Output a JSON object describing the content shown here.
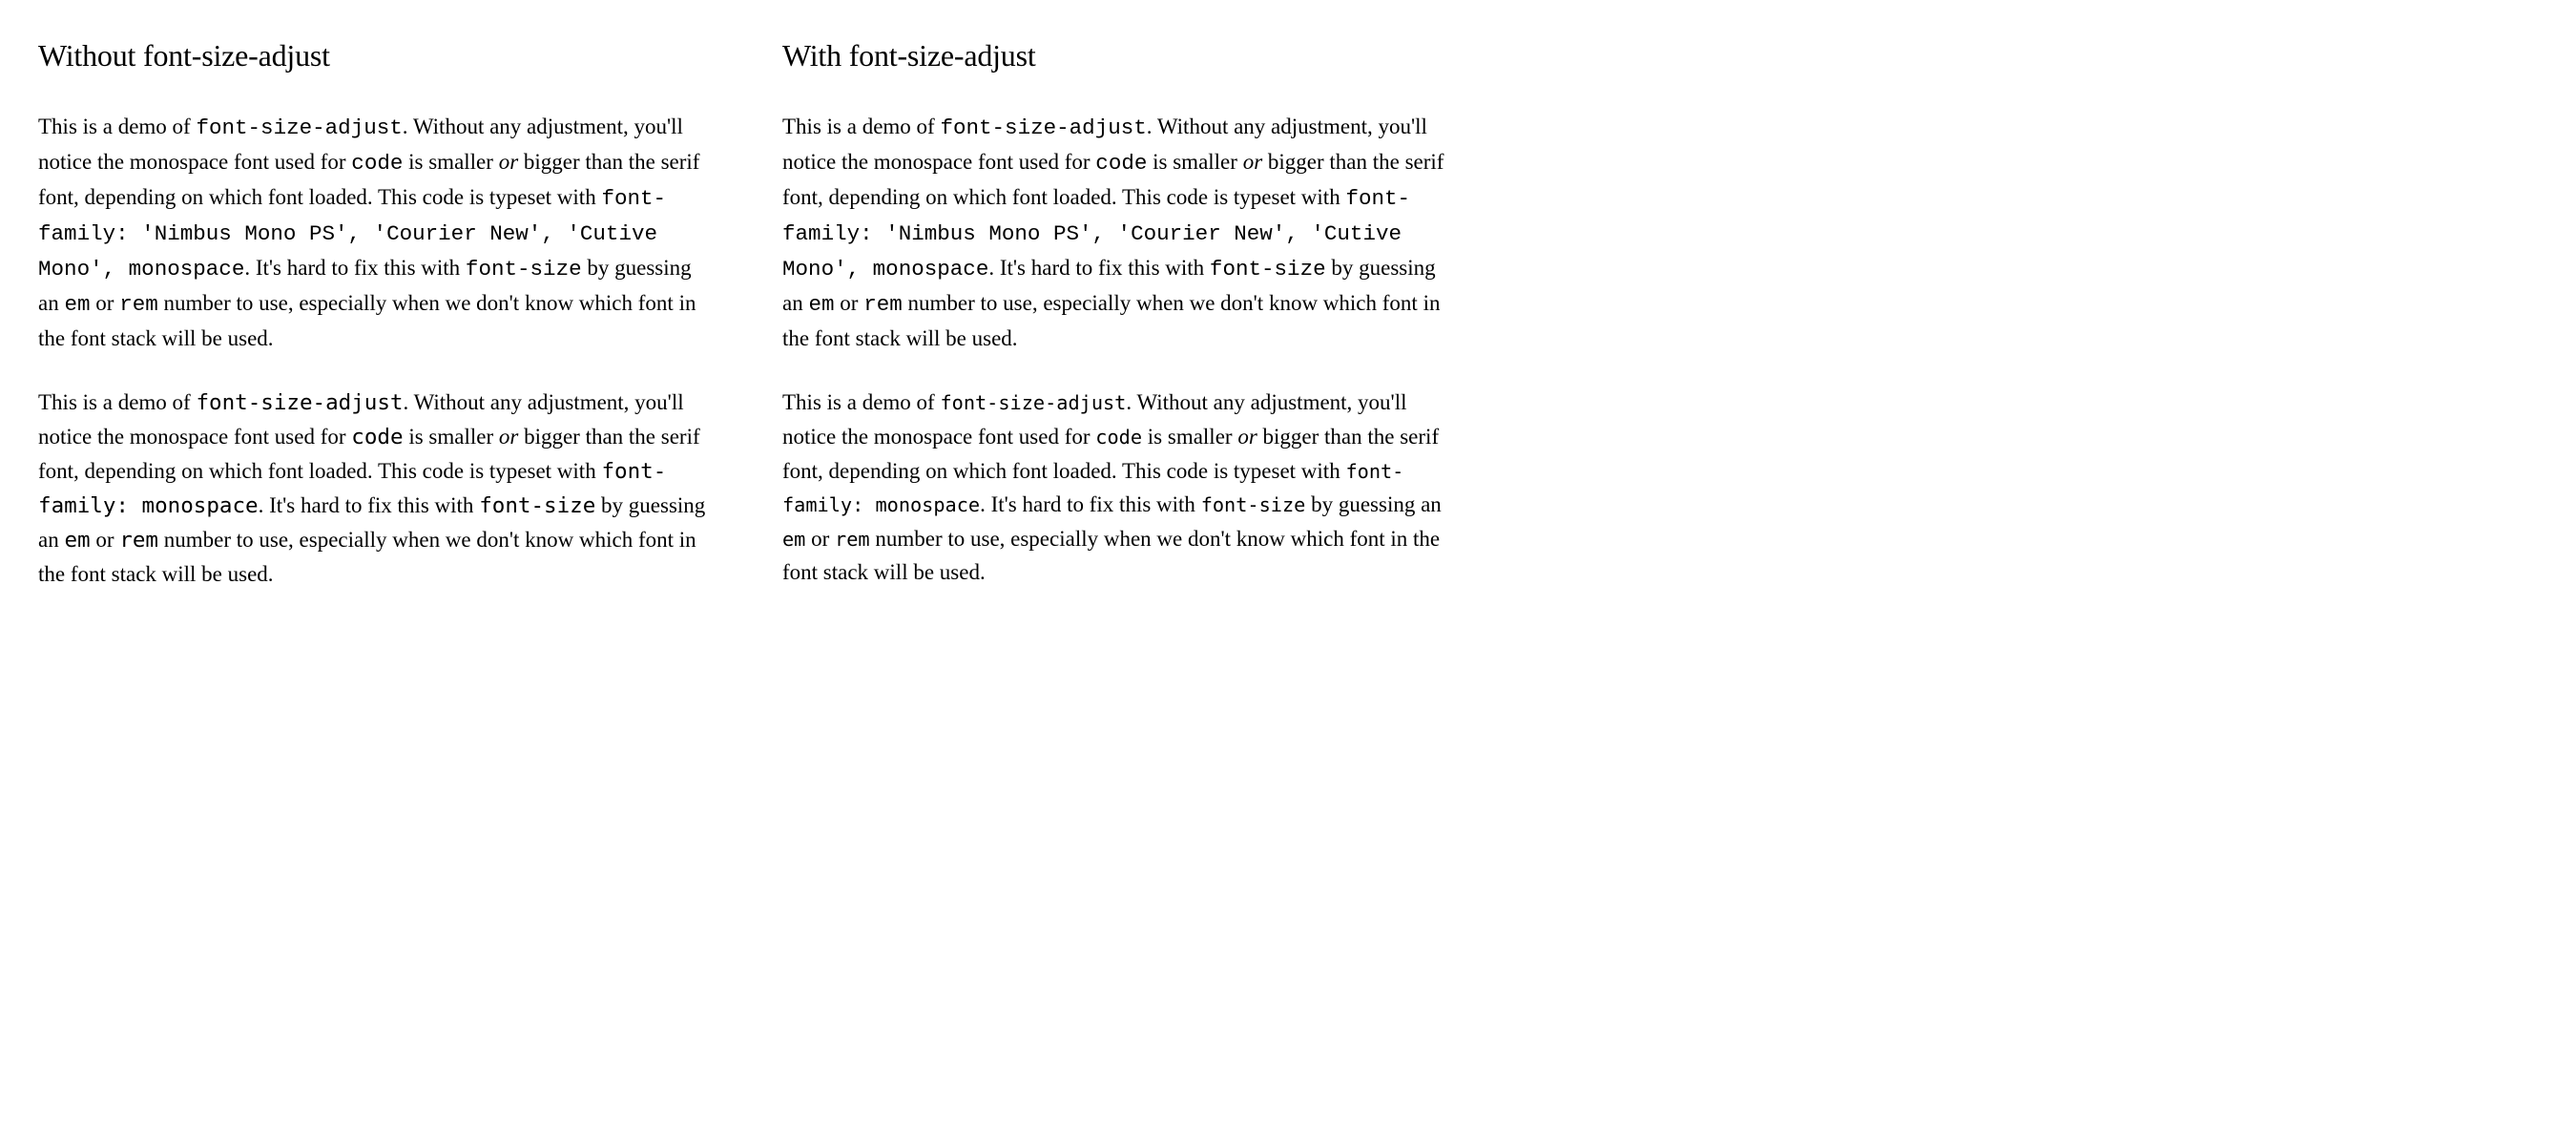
{
  "left": {
    "heading": "Without font-size-adjust",
    "para1": {
      "t1": "This is a demo of ",
      "c1": "font-size-adjust",
      "t2": ". Without any adjustment, you'll notice the monospace font used for ",
      "c2": "code",
      "t3": " is smaller ",
      "em1": "or",
      "t4": " bigger than the serif font, depending on which font loaded. This code is typeset with ",
      "c3": "font-family: 'Nimbus Mono PS', 'Courier New', 'Cutive Mono', monospace",
      "t5": ". It's hard to fix this with ",
      "c4": "font-size",
      "t6": " by guessing an ",
      "c5": "em",
      "t7": " or ",
      "c6": "rem",
      "t8": " number to use, especially when we don't know which font in the font stack will be used."
    },
    "para2": {
      "t1": "This is a demo of ",
      "c1": "font-size-adjust",
      "t2": ". Without any adjustment, you'll notice the monospace font used for ",
      "c2": "code",
      "t3": " is smaller ",
      "em1": "or",
      "t4": " bigger than the serif font, depending on which font loaded. This code is typeset with ",
      "c3": "font-family: monospace",
      "t5": ". It's hard to fix this with ",
      "c4": "font-size",
      "t6": " by guessing an ",
      "c5": "em",
      "t7": " or ",
      "c6": "rem",
      "t8": " number to use, especially when we don't know which font in the font stack will be used."
    }
  },
  "right": {
    "heading": "With font-size-adjust",
    "para1": {
      "t1": "This is a demo of ",
      "c1": "font-size-adjust",
      "t2": ". Without any adjustment, you'll notice the monospace font used for ",
      "c2": "code",
      "t3": " is smaller ",
      "em1": "or",
      "t4": " bigger than the serif font, depending on which font loaded. This code is typeset with ",
      "c3": "font-family: 'Nimbus Mono PS', 'Courier New', 'Cutive Mono', monospace",
      "t5": ". It's hard to fix this with ",
      "c4": "font-size",
      "t6": " by guessing an ",
      "c5": "em",
      "t7": " or ",
      "c6": "rem",
      "t8": " number to use, especially when we don't know which font in the font stack will be used."
    },
    "para2": {
      "t1": "This is a demo of ",
      "c1": "font-size-adjust",
      "t2": ". Without any adjustment, you'll notice the monospace font used for ",
      "c2": "code",
      "t3": " is smaller ",
      "em1": "or",
      "t4": " bigger than the serif font, depending on which font loaded. This code is typeset with ",
      "c3": "font-family: monospace",
      "t5": ". It's hard to fix this with ",
      "c4": "font-size",
      "t6": " by guessing an ",
      "c5": "em",
      "t7": " or ",
      "c6": "rem",
      "t8": " number to use, especially when we don't know which font in the font stack will be used."
    }
  }
}
